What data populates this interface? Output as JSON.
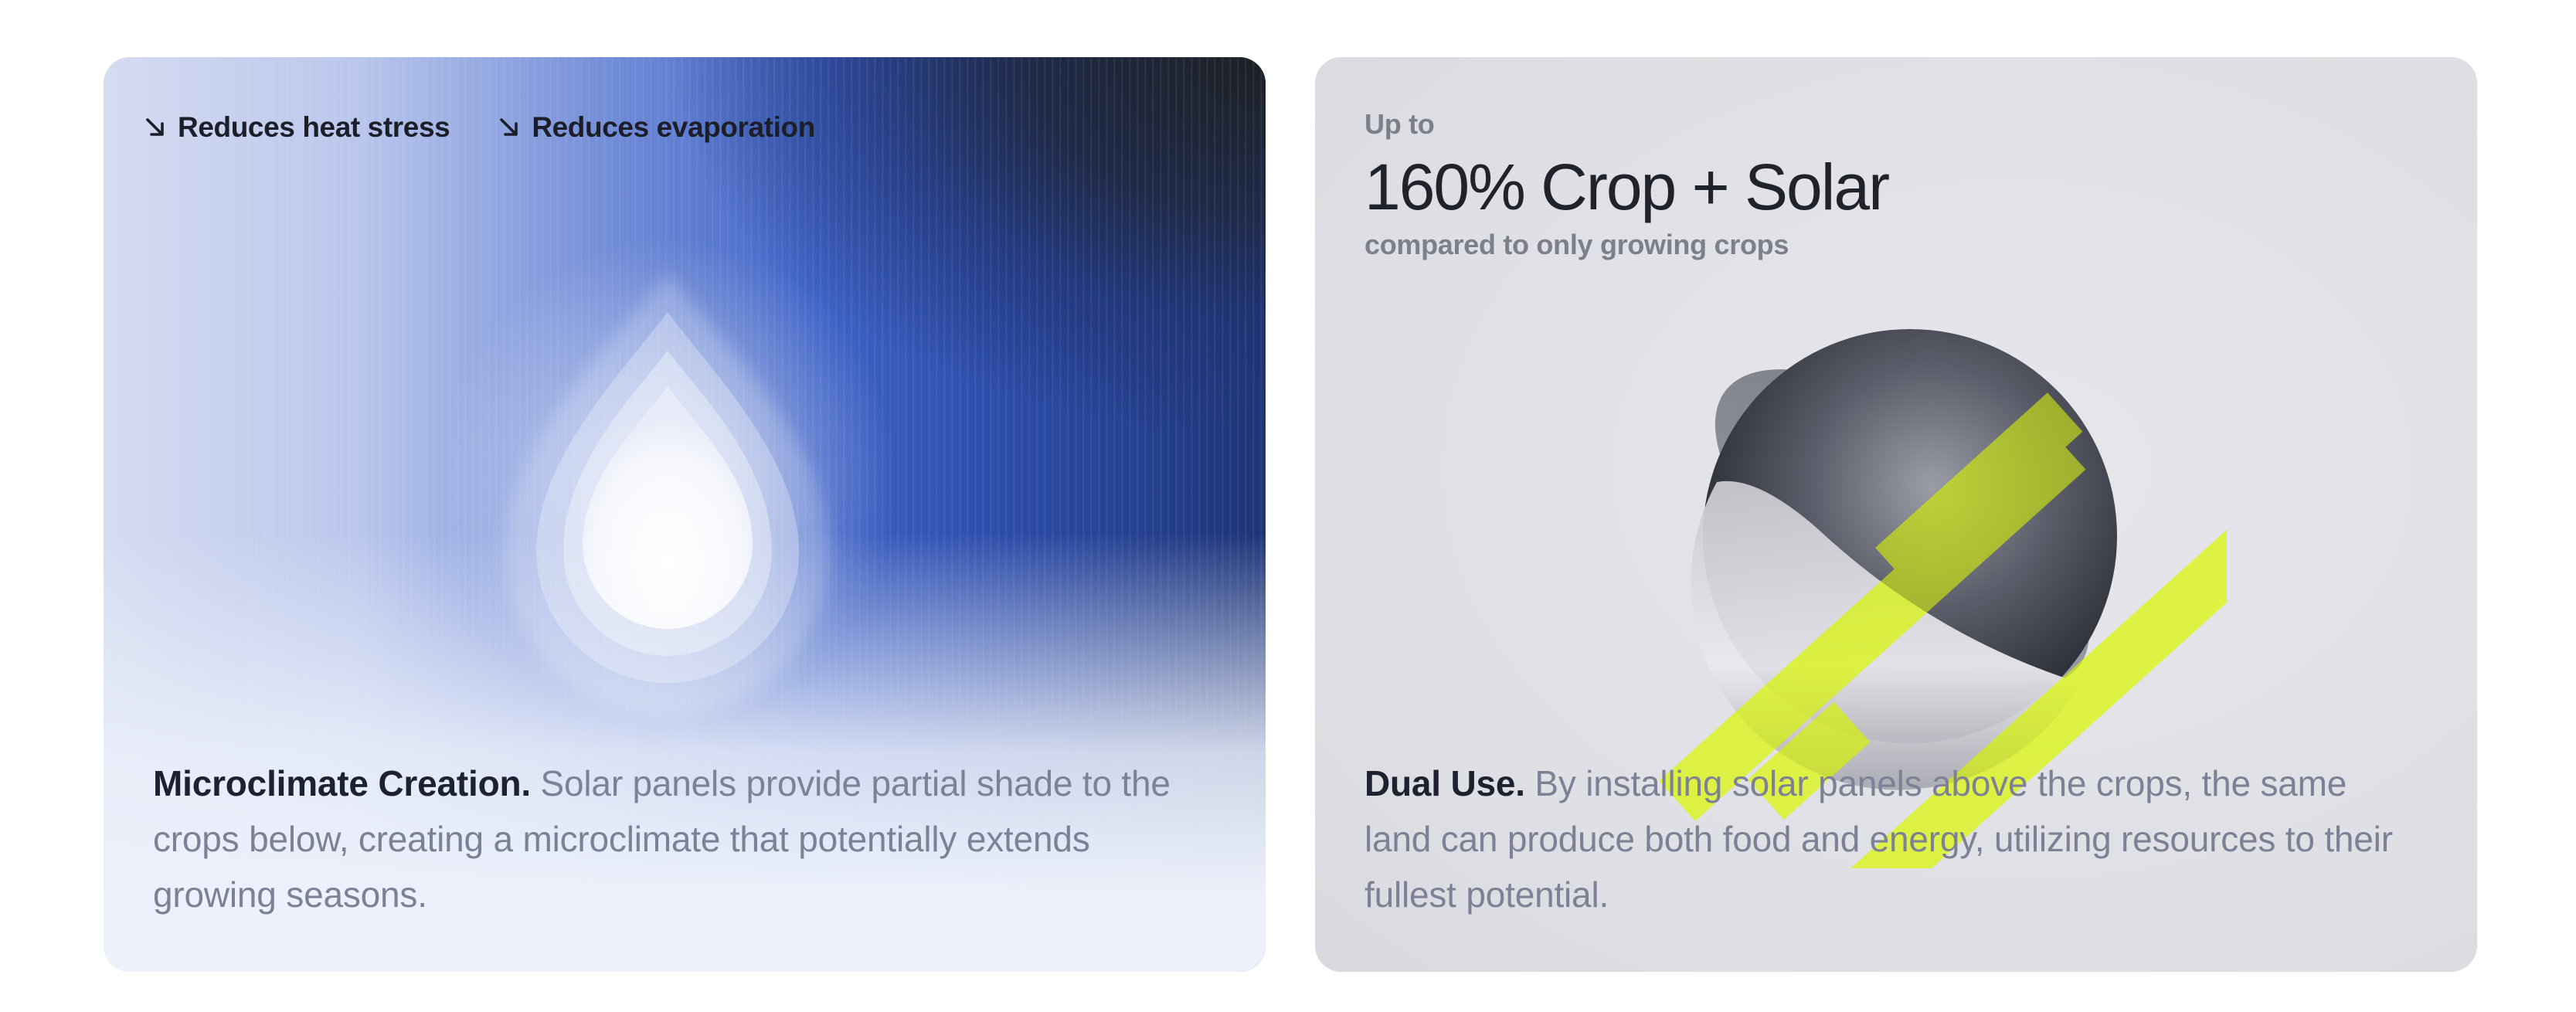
{
  "left_card": {
    "tags": [
      {
        "icon": "arrow-down-right-icon",
        "label": "Reduces heat stress"
      },
      {
        "icon": "arrow-down-right-icon",
        "label": "Reduces evaporation"
      }
    ],
    "illustration": "water-drop-icon",
    "lead": "Microclimate Creation.",
    "body": " Solar panels provide partial shade to the crops below, creating a microclimate that potentially extends growing seasons."
  },
  "right_card": {
    "stat_prefix": "Up to",
    "stat_value": "160% Crop + Solar",
    "stat_caption": "compared to only growing crops",
    "illustration": "sphere-with-solar-panels-icon",
    "lead": "Dual Use.",
    "body": " By installing solar panels above the crops, the same land can produce both food and energy, utilizing resources to their fullest potential."
  },
  "colors": {
    "accent_lime": "#e8ff3a",
    "deep_blue": "#2c4ca8",
    "text_dark": "#1e2130",
    "text_muted": "#7d8196"
  }
}
